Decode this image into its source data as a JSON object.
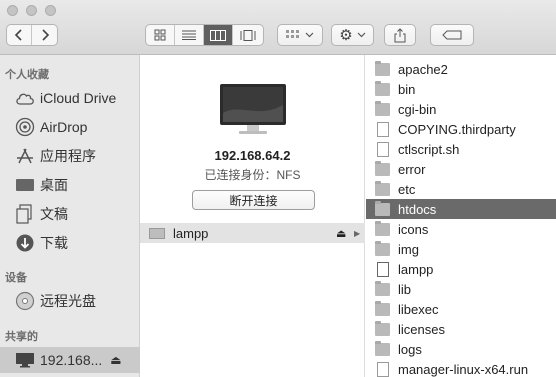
{
  "toolbar": {
    "view_modes": [
      "icon-view",
      "list-view",
      "column-view",
      "gallery-view"
    ],
    "active_view": "column-view"
  },
  "sidebar": {
    "favorites_header": "个人收藏",
    "favorites": [
      {
        "label": "iCloud Drive",
        "icon": "cloud-icon"
      },
      {
        "label": "AirDrop",
        "icon": "airdrop-icon"
      },
      {
        "label": "应用程序",
        "icon": "applications-icon"
      },
      {
        "label": "桌面",
        "icon": "desktop-icon"
      },
      {
        "label": "文稿",
        "icon": "documents-icon"
      },
      {
        "label": "下载",
        "icon": "downloads-icon"
      }
    ],
    "devices_header": "设备",
    "devices": [
      {
        "label": "远程光盘",
        "icon": "disc-icon"
      }
    ],
    "shared_header": "共享的",
    "shared": [
      {
        "label": "192.168...",
        "icon": "display-icon",
        "eject": "⏏"
      }
    ]
  },
  "server": {
    "address": "192.168.64.2",
    "connected_as": "已连接身份：NFS",
    "disconnect_label": "断开连接"
  },
  "column1": {
    "items": [
      {
        "label": "lampp",
        "eject": "⏏",
        "arrow": "▶"
      }
    ]
  },
  "column2": {
    "selected": "htdocs",
    "items": [
      {
        "label": "apache2",
        "type": "folder"
      },
      {
        "label": "bin",
        "type": "folder"
      },
      {
        "label": "cgi-bin",
        "type": "folder"
      },
      {
        "label": "COPYING.thirdparty",
        "type": "file"
      },
      {
        "label": "ctlscript.sh",
        "type": "file"
      },
      {
        "label": "error",
        "type": "folder"
      },
      {
        "label": "etc",
        "type": "folder"
      },
      {
        "label": "htdocs",
        "type": "folder"
      },
      {
        "label": "icons",
        "type": "folder"
      },
      {
        "label": "img",
        "type": "folder"
      },
      {
        "label": "lampp",
        "type": "exec"
      },
      {
        "label": "lib",
        "type": "folder"
      },
      {
        "label": "libexec",
        "type": "folder"
      },
      {
        "label": "licenses",
        "type": "folder"
      },
      {
        "label": "logs",
        "type": "folder"
      },
      {
        "label": "manager-linux-x64.run",
        "type": "file"
      }
    ]
  }
}
